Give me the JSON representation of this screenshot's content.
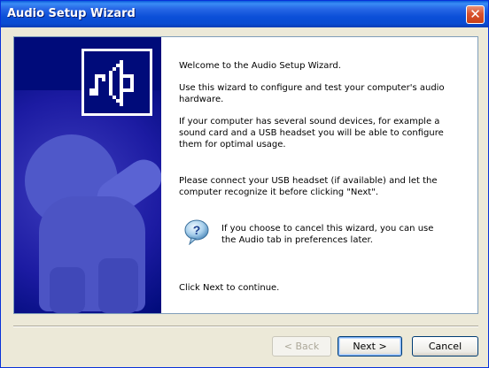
{
  "window": {
    "title": "Audio Setup Wizard",
    "close_label": "✕"
  },
  "content": {
    "welcome": "Welcome to the Audio Setup Wizard.",
    "intro": "Use this wizard to configure and test your computer's audio hardware.",
    "devices": "If your computer has several sound devices, for example a sound card and a USB headset you will be able to configure them for optimal usage.",
    "connect": "Please connect your USB headset (if available) and let the computer recognize it before clicking \"Next\".",
    "help": "If you choose to cancel this wizard, you can use the Audio tab in preferences later.",
    "continue": "Click Next to continue."
  },
  "buttons": {
    "back": "< Back",
    "next": "Next >",
    "cancel": "Cancel"
  },
  "colors": {
    "side_panel": "#000b7a",
    "titlebar": "#0a4cd2"
  },
  "icons": {
    "speaker": "speaker-icon",
    "help": "help-question-icon",
    "close": "close-icon"
  }
}
